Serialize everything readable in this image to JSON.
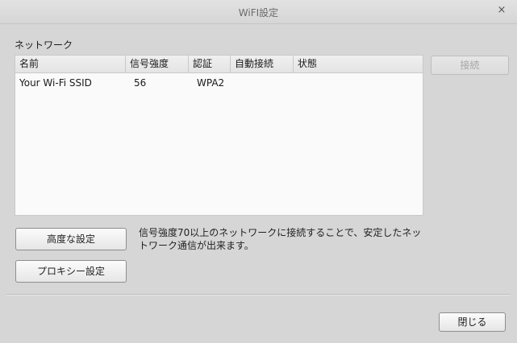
{
  "window": {
    "title": "WiFI設定",
    "close_glyph": "×",
    "close_icon": "close-icon"
  },
  "network": {
    "label": "ネットワーク",
    "columns": [
      "名前",
      "信号強度",
      "認証",
      "自動接続",
      "状態"
    ],
    "rows": [
      {
        "name": "Your Wi-Fi SSID",
        "signal": "56",
        "auth": "WPA2",
        "auto": "",
        "status": ""
      }
    ]
  },
  "buttons": {
    "connect": "接続",
    "advanced": "高度な設定",
    "proxy": "プロキシー設定",
    "close": "閉じる"
  },
  "info": {
    "line1": "信号強度70以上のネットワークに接続することで、安定したネッ",
    "line2": "トワーク通信が出来ます。"
  }
}
